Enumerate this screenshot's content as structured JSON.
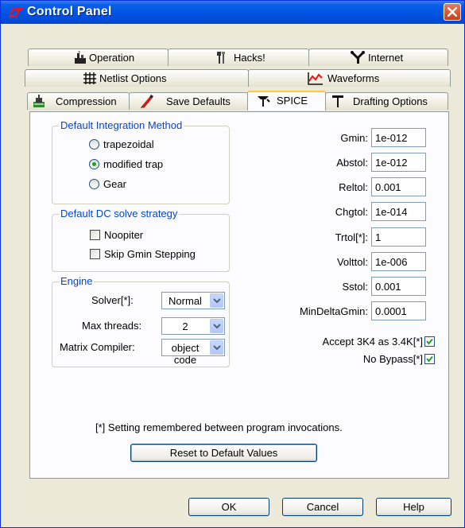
{
  "window": {
    "title": "Control Panel"
  },
  "tabs": {
    "row1": [
      {
        "label": "Operation",
        "icon": "operation-icon"
      },
      {
        "label": "Hacks!",
        "icon": "hacks-icon"
      },
      {
        "label": "Internet",
        "icon": "internet-icon"
      }
    ],
    "row2": [
      {
        "label": "Netlist Options",
        "icon": "netlist-icon"
      },
      {
        "label": "Waveforms",
        "icon": "waveforms-icon"
      }
    ],
    "row3": [
      {
        "label": "Compression",
        "icon": "compression-icon"
      },
      {
        "label": "Save Defaults",
        "icon": "save-defaults-icon"
      },
      {
        "label": "SPICE",
        "icon": "spice-icon",
        "active": true
      },
      {
        "label": "Drafting Options",
        "icon": "drafting-icon"
      }
    ]
  },
  "integration": {
    "title": "Default Integration Method",
    "options": [
      "trapezoidal",
      "modified trap",
      "Gear"
    ],
    "selected": "modified trap"
  },
  "dc_solve": {
    "title": "Default DC solve strategy",
    "options": [
      {
        "label": "Noopiter",
        "checked": false
      },
      {
        "label": "Skip Gmin Stepping",
        "checked": false
      }
    ]
  },
  "engine": {
    "title": "Engine",
    "solver": {
      "label": "Solver[*]:",
      "value": "Normal"
    },
    "max_threads": {
      "label": "Max threads:",
      "value": "2"
    },
    "matrix_compiler": {
      "label": "Matrix Compiler:",
      "value": "object code"
    }
  },
  "params": [
    {
      "label": "Gmin:",
      "value": "1e-012"
    },
    {
      "label": "Abstol:",
      "value": "1e-012"
    },
    {
      "label": "Reltol:",
      "value": "0.001"
    },
    {
      "label": "Chgtol:",
      "value": "1e-014"
    },
    {
      "label": "Trtol[*]:",
      "value": "1"
    },
    {
      "label": "Volttol:",
      "value": "1e-006"
    },
    {
      "label": "Sstol:",
      "value": "0.001"
    },
    {
      "label": "MinDeltaGmin:",
      "value": "0.0001"
    }
  ],
  "checks": [
    {
      "label": "Accept 3K4 as 3.4K[*]",
      "checked": true
    },
    {
      "label": "No Bypass[*]",
      "checked": true
    }
  ],
  "note": "[*] Setting remembered between program invocations.",
  "reset_button": "Reset to Default Values",
  "buttons": {
    "ok": "OK",
    "cancel": "Cancel",
    "help": "Help"
  },
  "colors": {
    "title_bar": "#0054e3",
    "group_title": "#0046d5",
    "dialog_bg": "#ece9d8",
    "active_tab_highlight": "#ffc83c"
  }
}
